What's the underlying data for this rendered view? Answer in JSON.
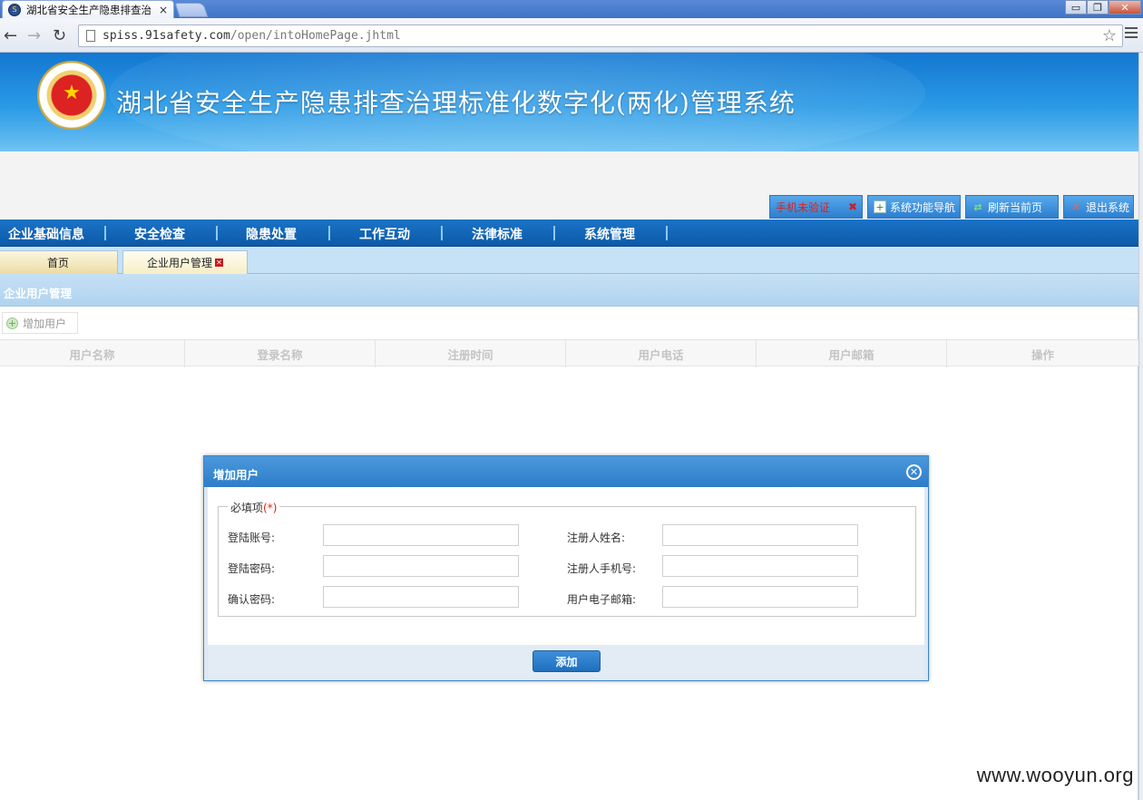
{
  "browser": {
    "tab_title": "湖北省安全生产隐患排查治",
    "tab_close": "×",
    "url_host": "spiss.91safety.com",
    "url_path": "/open/intoHomePage.jhtml",
    "win_minimize": "▭",
    "win_restore": "❐",
    "win_close": "✕"
  },
  "header": {
    "title": "湖北省安全生产隐患排查治理标准化数字化(两化)管理系统",
    "buttons": {
      "verify": "手机未验证",
      "nav": "系统功能导航",
      "refresh": "刷新当前页",
      "logout": "退出系统"
    }
  },
  "main_nav": {
    "items": [
      "企业基础信息",
      "安全检查",
      "隐患处置",
      "工作互动",
      "法律标准",
      "系统管理"
    ]
  },
  "tabs": {
    "home": "首页",
    "users": "企业用户管理"
  },
  "panel": {
    "title": "企业用户管理",
    "add_button": "增加用户",
    "columns": [
      "用户名称",
      "登录名称",
      "注册时间",
      "用户电话",
      "用户邮箱",
      "操作"
    ]
  },
  "dialog": {
    "title": "增加用户",
    "legend": "必填项",
    "legend_req": "(*)",
    "fields": {
      "login_account": "登陆账号:",
      "login_password": "登陆密码:",
      "confirm_password": "确认密码:",
      "registrant_name": "注册人姓名:",
      "registrant_phone": "注册人手机号:",
      "email": "用户电子邮箱:"
    },
    "submit": "添加"
  },
  "watermark": "www.wooyun.org",
  "colors": {
    "banner_blue": "#1377d1",
    "nav_blue": "#0c5aa8",
    "dialog_header": "#2d7dc8",
    "tab_bar": "#c6e2f7"
  }
}
